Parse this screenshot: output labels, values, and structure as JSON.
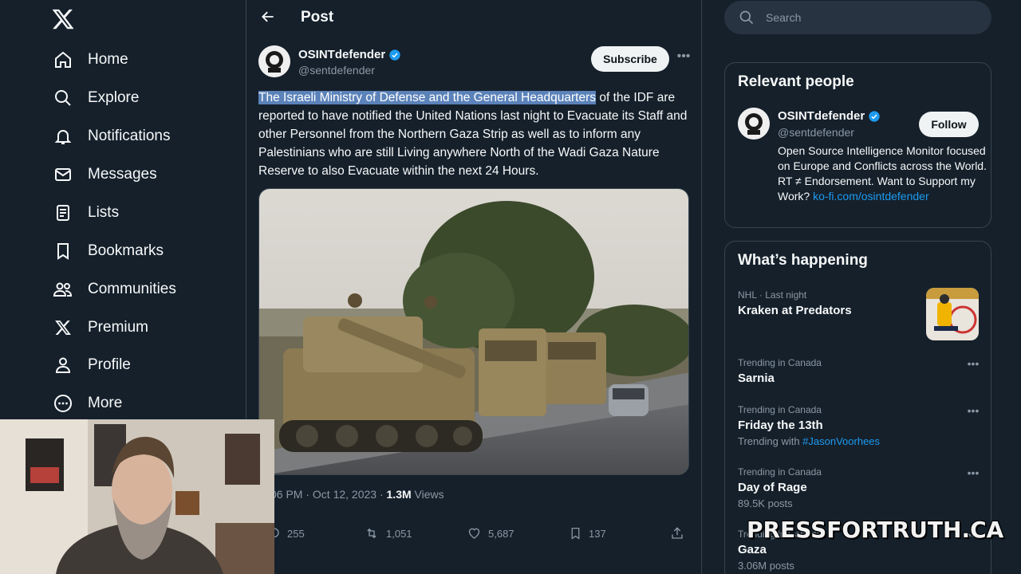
{
  "nav": {
    "items": [
      {
        "label": "Home",
        "icon": "home-icon"
      },
      {
        "label": "Explore",
        "icon": "search-icon"
      },
      {
        "label": "Notifications",
        "icon": "bell-icon"
      },
      {
        "label": "Messages",
        "icon": "envelope-icon"
      },
      {
        "label": "Lists",
        "icon": "list-icon"
      },
      {
        "label": "Bookmarks",
        "icon": "bookmark-icon"
      },
      {
        "label": "Communities",
        "icon": "people-icon"
      },
      {
        "label": "Premium",
        "icon": "x-logo-icon"
      },
      {
        "label": "Profile",
        "icon": "person-icon"
      },
      {
        "label": "More",
        "icon": "more-circle-icon"
      }
    ]
  },
  "header": {
    "title": "Post"
  },
  "post": {
    "author_name": "OSINTdefender",
    "author_handle": "@sentdefender",
    "subscribe_label": "Subscribe",
    "text_highlight": "The Israeli Ministry of Defense and the General Headquarters",
    "text_rest": " of the IDF are reported to have notified the United Nations last night to Evacuate its Staff and other Personnel from the Northern Gaza Strip as well as to inform any Palestinians who are still Living anywhere North of the Wadi Gaza Nature Reserve to also Evacuate within the next 24 Hours.",
    "meta_time": "06 PM · Oct 12, 2023 · ",
    "meta_views_count": "1.3M",
    "meta_views_label": " Views",
    "replies": "255",
    "reposts": "1,051",
    "likes": "5,687",
    "bookmarks": "137"
  },
  "search": {
    "placeholder": "Search"
  },
  "relevant": {
    "title": "Relevant people",
    "name": "OSINTdefender",
    "handle": "@sentdefender",
    "follow_label": "Follow",
    "bio": "Open Source Intelligence Monitor focused on Europe and Conflicts across the World. RT ≠ Endorsement. Want to Support my Work? ",
    "bio_link": "ko-fi.com/osintdefender"
  },
  "happening": {
    "title": "What’s happening",
    "trends": [
      {
        "context": "NHL · Last night",
        "topic": "Kraken at Predators",
        "sub": ""
      },
      {
        "context": "Trending in Canada",
        "topic": "Sarnia",
        "sub": ""
      },
      {
        "context": "Trending in Canada",
        "topic": "Friday the 13th",
        "sub_prefix": "Trending with ",
        "sub_tag": "#JasonVoorhees"
      },
      {
        "context": "Trending in Canada",
        "topic": "Day of Rage",
        "sub": "89.5K posts"
      },
      {
        "context": "Trending in Canada",
        "topic": "Gaza",
        "sub": "3.06M posts"
      }
    ]
  },
  "watermark": "PRESSFORTRUTH.CA",
  "colors": {
    "background": "#15202b",
    "accent": "#1d9bf0",
    "border": "#38444d",
    "muted": "#8b98a5"
  }
}
